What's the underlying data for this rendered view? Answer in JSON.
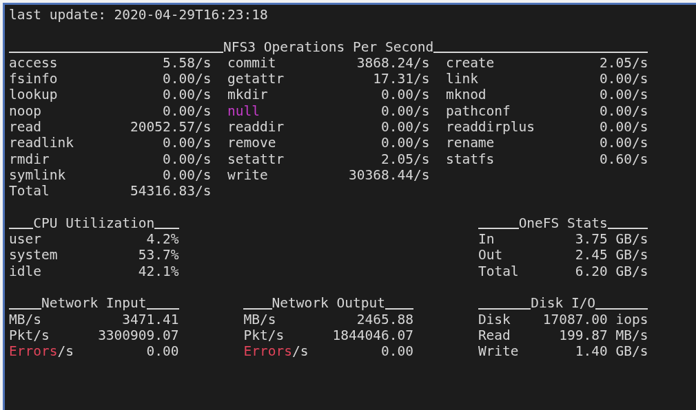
{
  "last_update": "last update: 2020-04-29T16:23:18",
  "nfs_operations": {
    "title": "NFS3 Operations Per Second",
    "rows": [
      [
        {
          "name": "access",
          "value": "5.58/s"
        },
        {
          "name": "commit",
          "value": "3868.24/s"
        },
        {
          "name": "create",
          "value": "2.05/s"
        }
      ],
      [
        {
          "name": "fsinfo",
          "value": "0.00/s"
        },
        {
          "name": "getattr",
          "value": "17.31/s"
        },
        {
          "name": "link",
          "value": "0.00/s"
        }
      ],
      [
        {
          "name": "lookup",
          "value": "0.00/s"
        },
        {
          "name": "mkdir",
          "value": "0.00/s"
        },
        {
          "name": "mknod",
          "value": "0.00/s"
        }
      ],
      [
        {
          "name": "noop",
          "value": "0.00/s"
        },
        {
          "name": "null",
          "value": "0.00/s",
          "color": "#c43cc8"
        },
        {
          "name": "pathconf",
          "value": "0.00/s"
        }
      ],
      [
        {
          "name": "read",
          "value": "20052.57/s"
        },
        {
          "name": "readdir",
          "value": "0.00/s"
        },
        {
          "name": "readdirplus",
          "value": "0.00/s"
        }
      ],
      [
        {
          "name": "readlink",
          "value": "0.00/s"
        },
        {
          "name": "remove",
          "value": "0.00/s"
        },
        {
          "name": "rename",
          "value": "0.00/s"
        }
      ],
      [
        {
          "name": "rmdir",
          "value": "0.00/s"
        },
        {
          "name": "setattr",
          "value": "2.05/s"
        },
        {
          "name": "statfs",
          "value": "0.60/s"
        }
      ],
      [
        {
          "name": "symlink",
          "value": "0.00/s"
        },
        {
          "name": "write",
          "value": "30368.44/s"
        }
      ],
      [
        {
          "name": "Total",
          "value": "54316.83/s"
        }
      ]
    ]
  },
  "upper_panels": [
    {
      "title": "CPU Utilization",
      "rows": [
        {
          "label": "user",
          "value": "4.2%"
        },
        {
          "label": "system",
          "value": "53.7%"
        },
        {
          "label": "idle",
          "value": "42.1%"
        }
      ]
    },
    {
      "title": "OneFS Stats",
      "rows": [
        {
          "label": "In",
          "value": "3.75 GB/s"
        },
        {
          "label": "Out",
          "value": "2.45 GB/s"
        },
        {
          "label": "Total",
          "value": "6.20 GB/s"
        }
      ]
    }
  ],
  "lower_panels": [
    {
      "title": "Network Input",
      "rows": [
        {
          "label": "MB/s",
          "value": "3471.41"
        },
        {
          "label": "Pkt/s",
          "value": "3300909.07"
        },
        {
          "label": "Errors",
          "label_suffix": "/s",
          "color": "#e0445a",
          "value": "0.00"
        }
      ]
    },
    {
      "title": "Network Output",
      "rows": [
        {
          "label": "MB/s",
          "value": "2465.88"
        },
        {
          "label": "Pkt/s",
          "value": "1844046.07"
        },
        {
          "label": "Errors",
          "label_suffix": "/s",
          "color": "#e0445a",
          "value": "0.00"
        }
      ]
    },
    {
      "title": "Disk I/O",
      "rows": [
        {
          "label": "Disk",
          "value": "17087.00 iops"
        },
        {
          "label": "Read",
          "value": "199.87 MB/s"
        },
        {
          "label": "Write",
          "value": "1.40 GB/s"
        }
      ]
    }
  ]
}
